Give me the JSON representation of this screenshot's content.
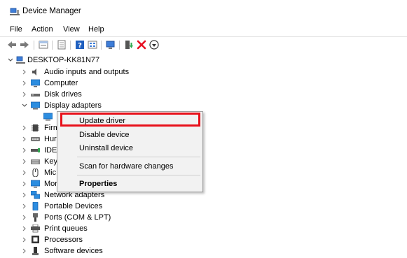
{
  "window": {
    "title": "Device Manager"
  },
  "menu": [
    "File",
    "Action",
    "View",
    "Help"
  ],
  "tree": {
    "root": "DESKTOP-KK81N77",
    "items": [
      {
        "label": "Audio inputs and outputs",
        "icon": "speaker-icon"
      },
      {
        "label": "Computer",
        "icon": "monitor-icon"
      },
      {
        "label": "Disk drives",
        "icon": "disk-icon"
      },
      {
        "label": "Display adapters",
        "icon": "display-adapter-icon",
        "expanded": true
      },
      {
        "label": "Firmware",
        "icon": "firmware-icon",
        "visible": "Firm"
      },
      {
        "label": "Human Interface Devices",
        "icon": "hid-icon",
        "visible": "Hur"
      },
      {
        "label": "IDE",
        "icon": "ide-icon",
        "visible": "IDE"
      },
      {
        "label": "Keyboards",
        "icon": "keyboard-icon",
        "visible": "Key"
      },
      {
        "label": "Mice",
        "icon": "mouse-icon",
        "visible": "Mic"
      },
      {
        "label": "Monitors",
        "icon": "monitor-icon",
        "visible": "Mor"
      },
      {
        "label": "Network adapters",
        "icon": "network-icon"
      },
      {
        "label": "Portable Devices",
        "icon": "portable-device-icon"
      },
      {
        "label": "Ports (COM & LPT)",
        "icon": "port-icon"
      },
      {
        "label": "Print queues",
        "icon": "printer-icon"
      },
      {
        "label": "Processors",
        "icon": "processor-icon"
      },
      {
        "label": "Software devices",
        "icon": "software-device-icon"
      }
    ]
  },
  "context_menu": {
    "items": [
      "Update driver",
      "Disable device",
      "Uninstall device",
      "Scan for hardware changes",
      "Properties"
    ],
    "highlighted": "Update driver",
    "highlight_color": "#e8101a"
  }
}
